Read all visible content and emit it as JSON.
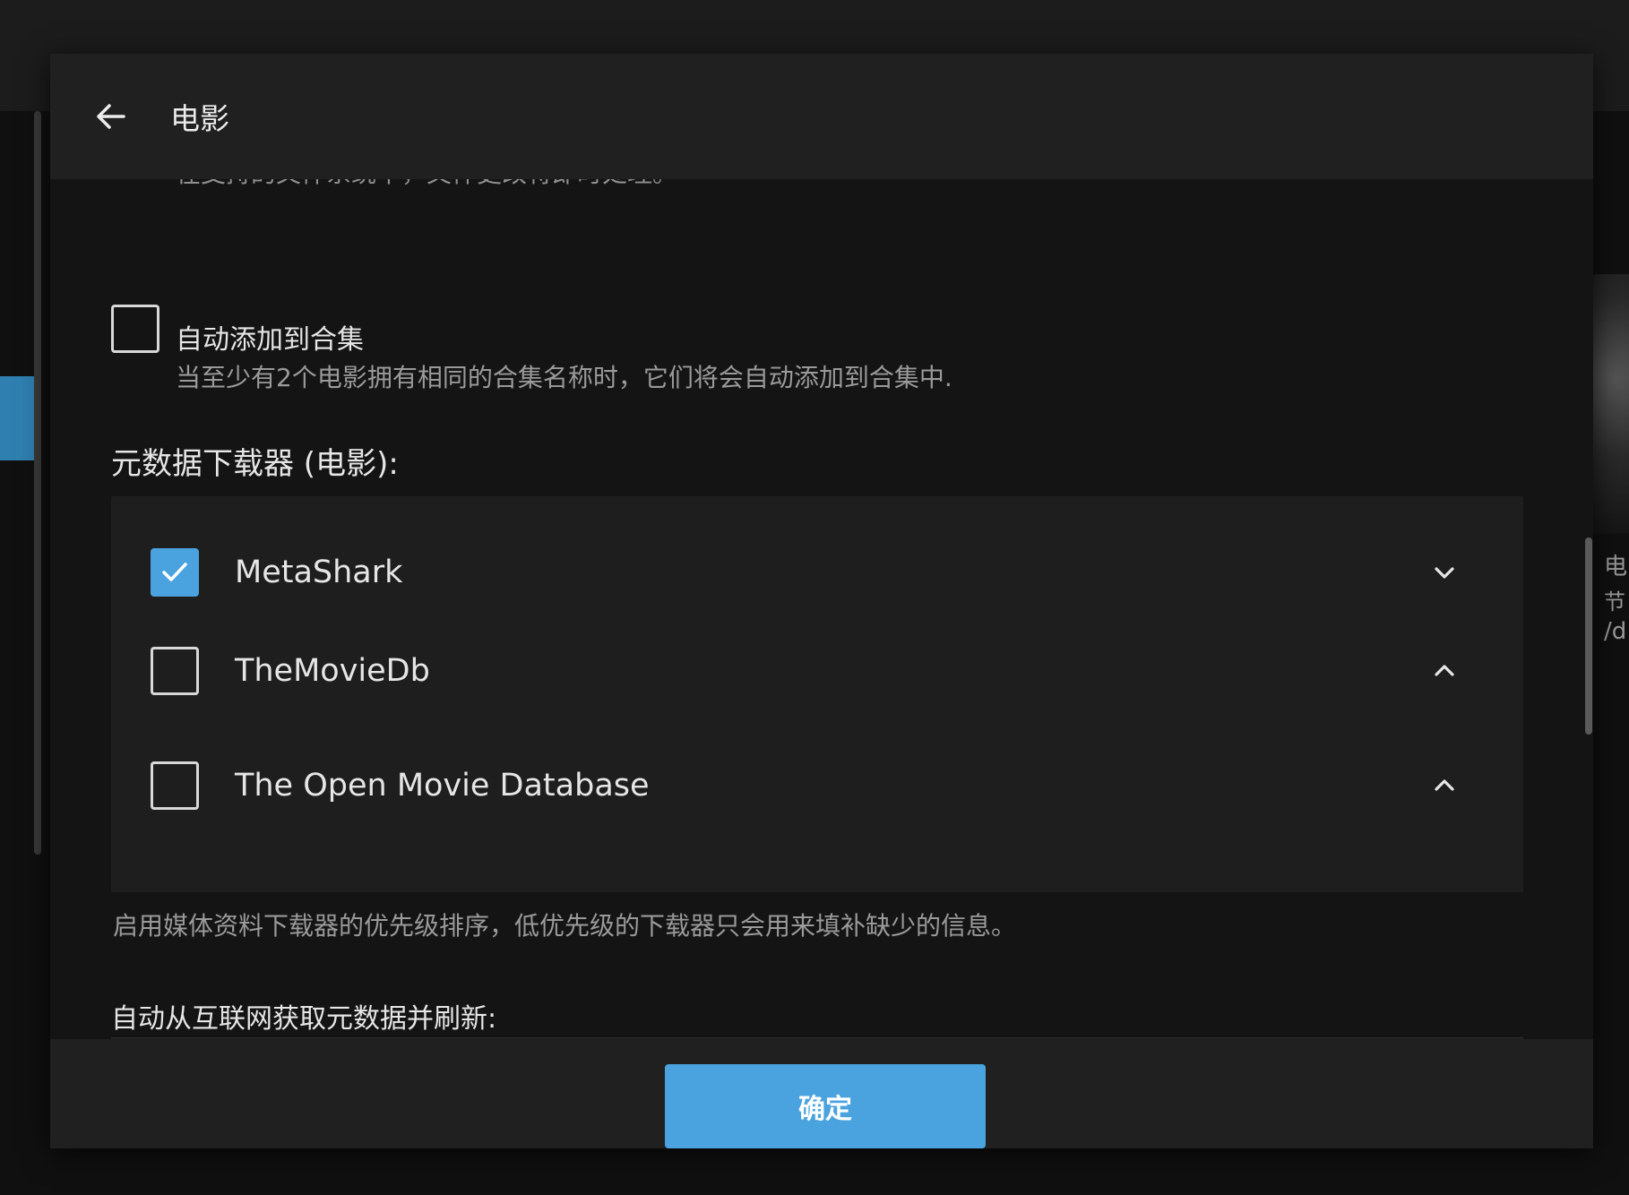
{
  "background": {
    "right_card_texts": [
      "电",
      "节",
      "/d"
    ]
  },
  "dialog": {
    "title": "电影",
    "cut_off_text": "在支持的文件系统中，文件更改将即时处理。",
    "collections": {
      "label": "自动添加到合集",
      "checked": false,
      "description": "当至少有2个电影拥有相同的合集名称时，它们将会自动添加到合集中."
    },
    "metadata_downloaders": {
      "label": "元数据下载器 (电影):",
      "items": [
        {
          "name": "MetaShark",
          "checked": true,
          "chevron": "chevron-down-icon"
        },
        {
          "name": "TheMovieDb",
          "checked": false,
          "chevron": "chevron-up-icon"
        },
        {
          "name": "The Open Movie Database",
          "checked": false,
          "chevron": "chevron-up-icon"
        }
      ],
      "hint": "启用媒体资料下载器的优先级排序，低优先级的下载器只会用来填补缺少的信息。"
    },
    "auto_refresh_label": "自动从互联网获取元数据并刷新:",
    "confirm_label": "确定"
  },
  "colors": {
    "accent": "#4aa3df",
    "background": "#141414",
    "header": "#202020",
    "list_bg": "#1e1e1e"
  }
}
